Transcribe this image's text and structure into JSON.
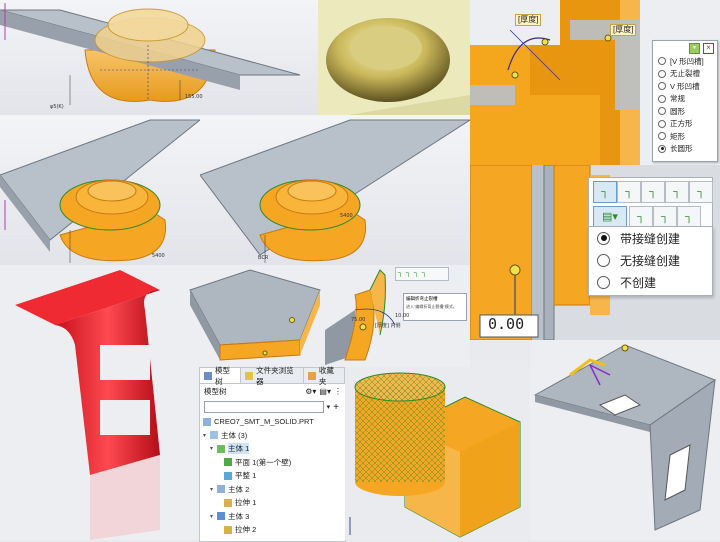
{
  "dims": {
    "d1": "φ5(K)",
    "d2": "155.00",
    "d3": "5400",
    "d4": "5400",
    "d5": "BCR",
    "d6": "5400"
  },
  "top_right": {
    "thickness_label_1": "[厚度]",
    "thickness_label_2": "[厚度]"
  },
  "shape_menu": {
    "items": [
      "[V 形凹槽]",
      "无止裂槽",
      "V 形凹槽",
      "常规",
      "圆形",
      "正方形",
      "矩形",
      "长圆形"
    ],
    "selected": "长圆形"
  },
  "corner_panel": {
    "dim_value": "0.00",
    "options": [
      "带接缝创建",
      "无接缝创建",
      "不创建"
    ],
    "selected": "带接缝创建"
  },
  "mid_panel": {
    "tip_title": "编辑折弯止裂槽",
    "tip_text": "进入\"编辑折弯止裂槽\"模式。",
    "dim_1": "10.00",
    "dim_2": "[厚度] 内侧",
    "dim_3": "75.00"
  },
  "model_tree": {
    "tabs": [
      "模型树",
      "文件夹浏览器",
      "收藏夹"
    ],
    "toolbar_title": "模型树",
    "rows": [
      {
        "label": "CREO7_SMT_M_SOLID.PRT",
        "indent": 0,
        "icon": "part"
      },
      {
        "label": "主体 (3)",
        "indent": 0,
        "icon": "body-group"
      },
      {
        "label": "主体 1",
        "indent": 1,
        "icon": "body-sheet",
        "selected": true
      },
      {
        "label": "平面 1(第一个壁)",
        "indent": 2,
        "icon": "wall"
      },
      {
        "label": "平整 1",
        "indent": 2,
        "icon": "flat"
      },
      {
        "label": "主体 2",
        "indent": 1,
        "icon": "body"
      },
      {
        "label": "拉伸 1",
        "indent": 2,
        "icon": "extrude"
      },
      {
        "label": "主体 3",
        "indent": 1,
        "icon": "body"
      },
      {
        "label": "拉伸 2",
        "indent": 2,
        "icon": "extrude"
      }
    ]
  },
  "colors": {
    "orange": "#f5a623",
    "steel": "#a9b2bd",
    "red": "#e8202a",
    "yellow_highlight": "#f0e14a"
  }
}
